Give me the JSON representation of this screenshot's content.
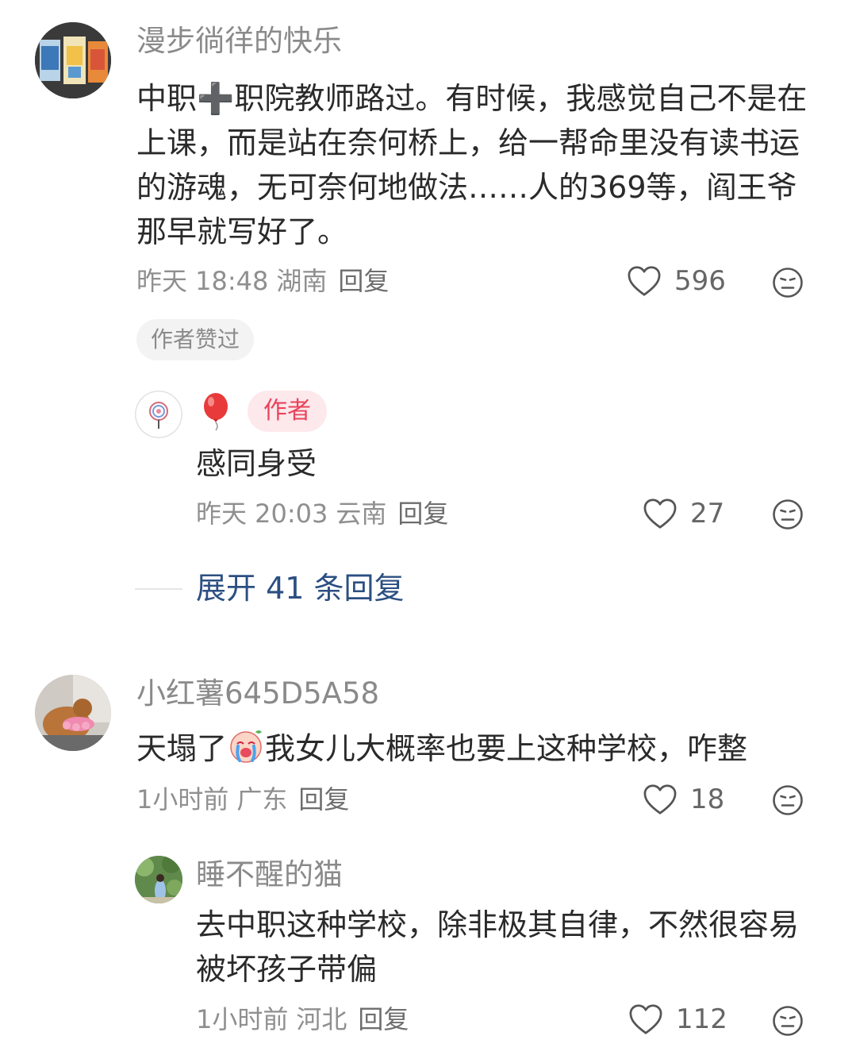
{
  "comments": [
    {
      "username": "漫步徜徉的快乐",
      "text": "中职➕职院教师路过。有时候，我感觉自己不是在上课，而是站在奈何桥上，给一帮命里没有读书运的游魂，无可奈何地做法……人的369等，阎王爷那早就写好了。",
      "time": "昨天 18:48",
      "location": "湖南",
      "reply_label": "回复",
      "likes": "596",
      "liked_badge": "作者赞过",
      "reply": {
        "username": "🎈",
        "author_tag": "作者",
        "text": "感同身受",
        "time": "昨天 20:03",
        "location": "云南",
        "reply_label": "回复",
        "likes": "27"
      },
      "expand_label": "展开 41 条回复"
    },
    {
      "username": "小红薯645D5A58",
      "text_before_emoji": "天塌了",
      "text_after_emoji": "我女儿大概率也要上这种学校，咋整",
      "time": "1小时前",
      "location": "广东",
      "reply_label": "回复",
      "likes": "18",
      "reply": {
        "username": "睡不醒的猫",
        "text": "去中职这种学校，除非极其自律，不然很容易被坏孩子带偏",
        "time": "1小时前",
        "location": "河北",
        "reply_label": "回复",
        "likes": "112"
      }
    }
  ]
}
